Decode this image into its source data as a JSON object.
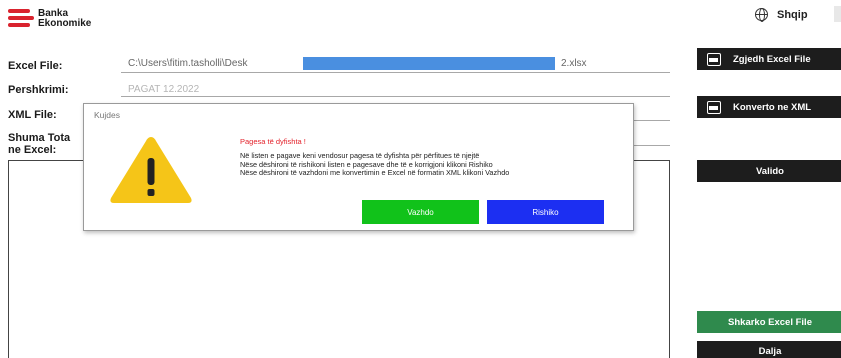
{
  "brand": {
    "line1": "Banka",
    "line2": "Ekonomike"
  },
  "language": {
    "label": "Shqip"
  },
  "form": {
    "excel_label": "Excel File:",
    "excel_value_start": "C:\\Users\\fitim.tasholli\\Desk",
    "excel_value_end": "2.xlsx",
    "desc_label": "Pershkrimi:",
    "desc_value": "PAGAT 12.2022",
    "xml_label": "XML File:",
    "sum_label_1": "Shuma Tota",
    "sum_label_2": "ne Excel:"
  },
  "side_buttons": {
    "select_excel": "Zgjedh Excel File",
    "convert_xml": "Konverto ne XML",
    "validate": "Valido",
    "download_excel": "Shkarko Excel File",
    "exit": "Dalja"
  },
  "dialog": {
    "title": "Kujdes",
    "message_title": "Pagesa të dyfishta !",
    "line1": "Në listen e pagave keni vendosur pagesa të dyfishta për përfitues të njejtë",
    "line2": "Nëse dëshironi të rishikoni listen e pagesave dhe të e korrigjoni klikoni Rishiko",
    "line3": "Nëse dëshironi të vazhdoni me konvertimin e Excel në formatin XML klikoni Vazhdo",
    "continue_label": "Vazhdo",
    "review_label": "Rishiko"
  },
  "icons": {
    "warning": "warning-triangle-icon",
    "globe": "globe-icon",
    "file": "file-icon"
  },
  "colors": {
    "brand_red": "#d9232e",
    "warning_yellow": "#f5c518",
    "message_red": "#e3222b",
    "continue_green": "#11c21a",
    "review_blue": "#1c2ff2",
    "download_green": "#2f8a4d"
  }
}
